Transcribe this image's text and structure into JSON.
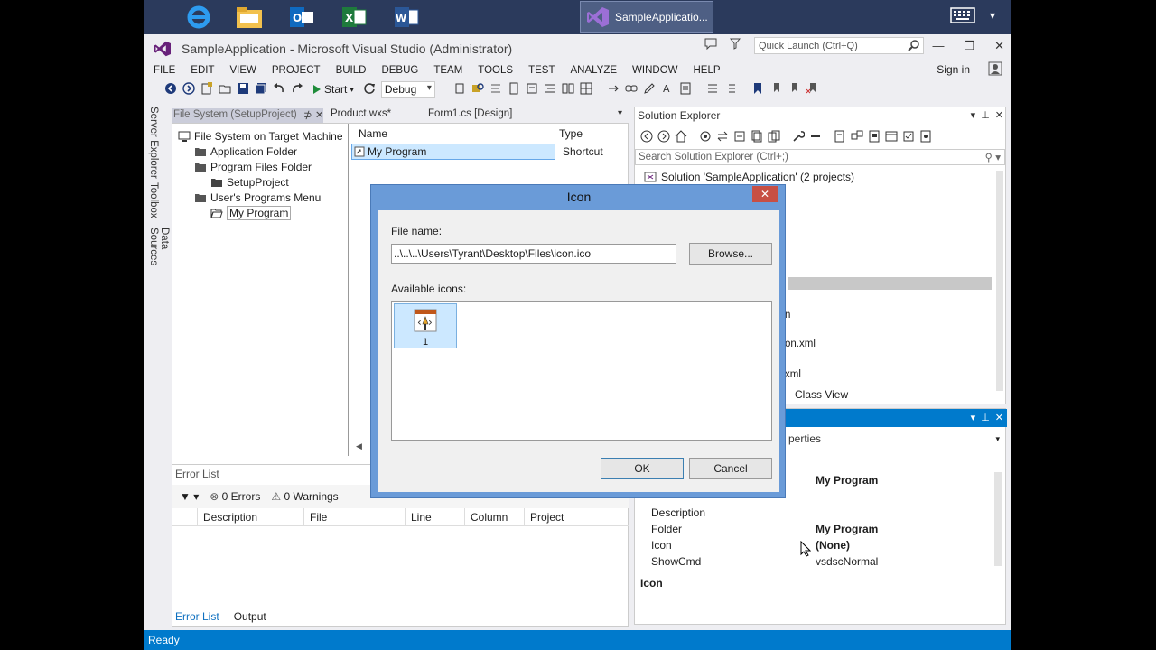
{
  "taskbar": {
    "active_app": "SampleApplicatio...",
    "apps": [
      "ie-icon",
      "folder-icon",
      "outlook-icon",
      "excel-icon",
      "word-icon"
    ]
  },
  "window": {
    "title": "SampleApplication - Microsoft Visual Studio (Administrator)",
    "quick_launch_placeholder": "Quick Launch (Ctrl+Q)",
    "sign_in": "Sign in"
  },
  "menu": [
    "FILE",
    "EDIT",
    "VIEW",
    "PROJECT",
    "BUILD",
    "DEBUG",
    "TEAM",
    "TOOLS",
    "TEST",
    "ANALYZE",
    "WINDOW",
    "HELP"
  ],
  "toolbar": {
    "start_label": "Start",
    "configuration": "Debug"
  },
  "side_tabs": [
    "Server Explorer",
    "Toolbox",
    "Data Sources"
  ],
  "doc_tabs": [
    "File System (SetupProject)",
    "Product.wxs*",
    "Form1.cs [Design]"
  ],
  "file_system": {
    "tree": [
      "File System on Target Machine",
      "Application Folder",
      "Program Files Folder",
      "SetupProject",
      "User's Programs Menu",
      "My Program"
    ],
    "columns": [
      "Name",
      "Type"
    ],
    "rows": [
      {
        "name": "My Program",
        "type": "Shortcut"
      }
    ]
  },
  "error_list": {
    "title": "Error List",
    "errors": "0 Errors",
    "warnings": "0 Warnings",
    "columns": [
      "Description",
      "File",
      "Line",
      "Column",
      "Project"
    ],
    "tabs": [
      "Error List",
      "Output"
    ]
  },
  "solution_explorer": {
    "title": "Solution Explorer",
    "search_placeholder": "Search Solution Explorer (Ctrl+;)",
    "root": "Solution 'SampleApplication' (2 projects)",
    "fragments": [
      "n",
      "on.xml",
      "xml"
    ],
    "class_view": "Class View"
  },
  "properties": {
    "selector": "perties",
    "header_value": "My Program",
    "rows": [
      {
        "key": "Description",
        "value": ""
      },
      {
        "key": "Folder",
        "value": "My Program"
      },
      {
        "key": "Icon",
        "value": "(None)"
      },
      {
        "key": "ShowCmd",
        "value": "vsdscNormal"
      }
    ],
    "desc_title": "Icon"
  },
  "status": "Ready",
  "dialog": {
    "title": "Icon",
    "close": "✕",
    "file_name_label": "File name:",
    "file_name_value": "..\\..\\..\\Users\\Tyrant\\Desktop\\Files\\icon.ico",
    "browse": "Browse...",
    "available_label": "Available icons:",
    "icon_number": "1",
    "ok": "OK",
    "cancel": "Cancel"
  }
}
